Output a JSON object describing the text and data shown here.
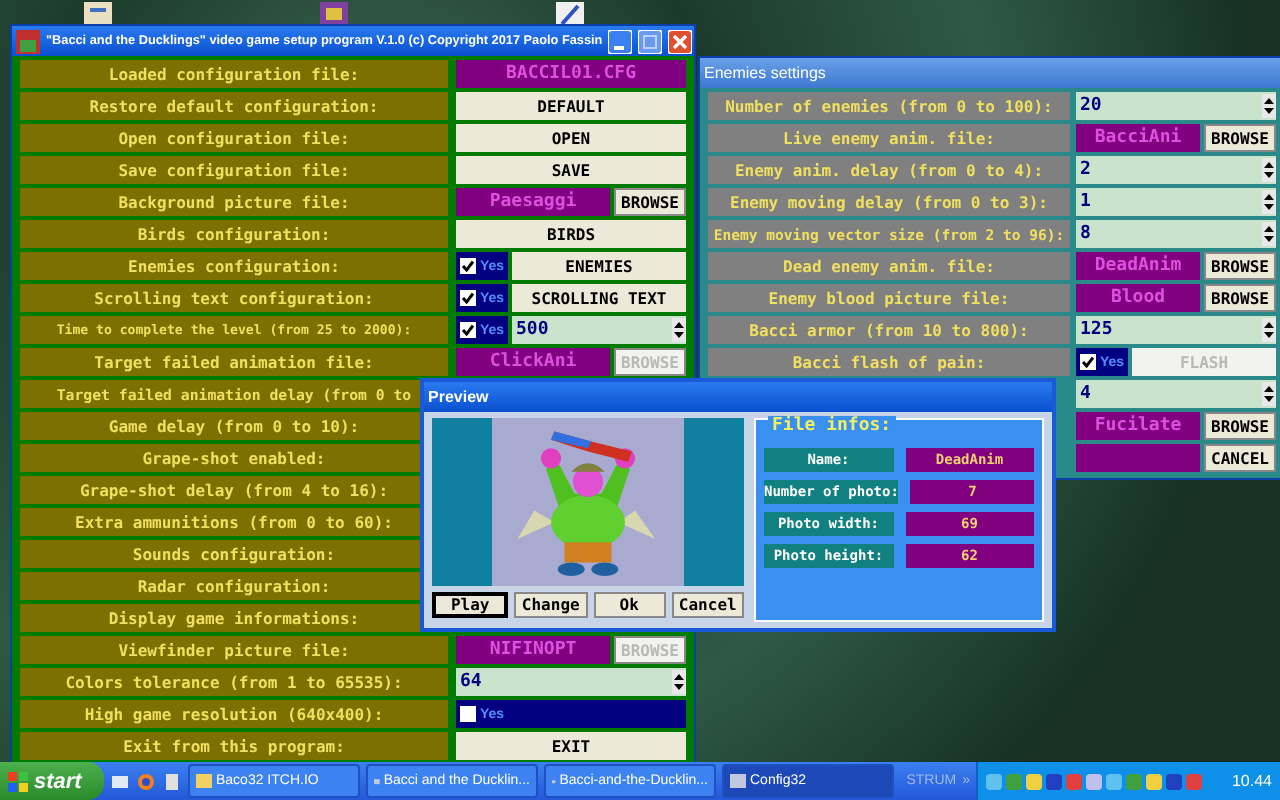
{
  "main_window": {
    "title": "\"Bacci and the Ducklings\" video game setup program V.1.0 (c) Copyright 2017 Paolo Fassin",
    "rows": [
      {
        "label": "Loaded configuration file:",
        "value": {
          "kind": "text",
          "text": "BACCIL01.CFG"
        }
      },
      {
        "label": "Restore default configuration:",
        "value": {
          "kind": "button",
          "text": "DEFAULT"
        }
      },
      {
        "label": "Open configuration file:",
        "value": {
          "kind": "button",
          "text": "OPEN"
        }
      },
      {
        "label": "Save configuration file:",
        "value": {
          "kind": "button",
          "text": "SAVE"
        }
      },
      {
        "label": "Background picture file:",
        "value": {
          "kind": "file",
          "text": "Paesaggi",
          "button": "BROWSE",
          "disabled": false
        }
      },
      {
        "label": "Birds configuration:",
        "value": {
          "kind": "button",
          "text": "BIRDS"
        }
      },
      {
        "label": "Enemies configuration:",
        "value": {
          "kind": "check_button",
          "checked": true,
          "check_label": "Yes",
          "button": "ENEMIES"
        }
      },
      {
        "label": "Scrolling text configuration:",
        "value": {
          "kind": "check_button",
          "checked": true,
          "check_label": "Yes",
          "button": "SCROLLING TEXT"
        }
      },
      {
        "label": "Time to complete the level (from 25 to 2000):",
        "value": {
          "kind": "check_spin",
          "checked": true,
          "check_label": "Yes",
          "text": "500"
        }
      },
      {
        "label": "Target failed animation file:",
        "value": {
          "kind": "file",
          "text": "ClickAni",
          "button": "BROWSE",
          "disabled": true
        }
      },
      {
        "label": "Target failed animation delay (from 0 to"
      },
      {
        "label": "Game delay (from 0 to 10):"
      },
      {
        "label": "Grape-shot enabled:"
      },
      {
        "label": "Grape-shot delay (from 4 to 16):"
      },
      {
        "label": "Extra ammunitions (from 0 to 60):"
      },
      {
        "label": "Sounds configuration:"
      },
      {
        "label": "Radar configuration:"
      },
      {
        "label": "Display game informations:"
      },
      {
        "label": "Viewfinder picture file:",
        "value": {
          "kind": "file",
          "text": "NIFINOPT",
          "button": "BROWSE",
          "disabled": true
        }
      },
      {
        "label": "Colors tolerance (from 1 to 65535):",
        "value": {
          "kind": "spin",
          "text": "64"
        }
      },
      {
        "label": "High game resolution (640x400):",
        "value": {
          "kind": "check",
          "checked": false,
          "check_label": "Yes"
        }
      },
      {
        "label": "Exit from this program:",
        "value": {
          "kind": "button",
          "text": "EXIT"
        }
      }
    ]
  },
  "enemies_window": {
    "title": "Enemies settings",
    "rows": [
      {
        "label": "Number of enemies (from 0 to 100):",
        "value": {
          "kind": "spin",
          "text": "20"
        }
      },
      {
        "label": "Live enemy anim. file:",
        "value": {
          "kind": "file",
          "text": "BacciAni",
          "button": "BROWSE",
          "disabled": false
        }
      },
      {
        "label": "Enemy anim. delay (from 0 to 4):",
        "value": {
          "kind": "spin",
          "text": "2"
        }
      },
      {
        "label": "Enemy moving delay (from 0 to 3):",
        "value": {
          "kind": "spin",
          "text": "1"
        }
      },
      {
        "label": "Enemy moving vector size (from 2 to 96):",
        "value": {
          "kind": "spin",
          "text": "8"
        }
      },
      {
        "label": "Dead enemy anim. file:",
        "value": {
          "kind": "file",
          "text": "DeadAnim",
          "button": "BROWSE",
          "disabled": false
        }
      },
      {
        "label": "Enemy blood picture file:",
        "value": {
          "kind": "file",
          "text": "Blood",
          "button": "BROWSE",
          "disabled": false
        }
      },
      {
        "label": "Bacci armor (from 10 to 800):",
        "value": {
          "kind": "spin",
          "text": "125"
        }
      },
      {
        "label": "Bacci flash of pain:",
        "value": {
          "kind": "check_button",
          "checked": true,
          "check_label": "Yes",
          "button": "FLASH",
          "disabled": true
        }
      },
      {
        "value": {
          "kind": "spin",
          "text": "4"
        }
      },
      {
        "value": {
          "kind": "file",
          "text": "Fucilate",
          "button": "BROWSE",
          "disabled": false
        }
      },
      {
        "value": {
          "kind": "file",
          "button": "CANCEL",
          "disabled": false
        }
      }
    ]
  },
  "preview_window": {
    "title": "Preview",
    "buttons": [
      {
        "label": "Play",
        "focused": true
      },
      {
        "label": "Change",
        "focused": false
      },
      {
        "label": "Ok",
        "focused": false
      },
      {
        "label": "Cancel",
        "focused": false
      }
    ],
    "file_infos": {
      "title": "File infos:",
      "rows": [
        {
          "label": "Name:",
          "value": "DeadAnim"
        },
        {
          "label": "Number of photo:",
          "value": "7"
        },
        {
          "label": "Photo width:",
          "value": "69"
        },
        {
          "label": "Photo height:",
          "value": "62"
        }
      ]
    }
  },
  "taskbar": {
    "start": "start",
    "tasks": [
      {
        "label": "Baco32 ITCH.IO",
        "selected": false
      },
      {
        "label": "Bacci and the Ducklin...",
        "selected": false
      },
      {
        "label": "Bacci-and-the-Ducklin...",
        "selected": false
      },
      {
        "label": "Config32",
        "selected": true
      }
    ],
    "toolbar_label": "STRUM",
    "chevron": "»",
    "clock": "10.44"
  }
}
